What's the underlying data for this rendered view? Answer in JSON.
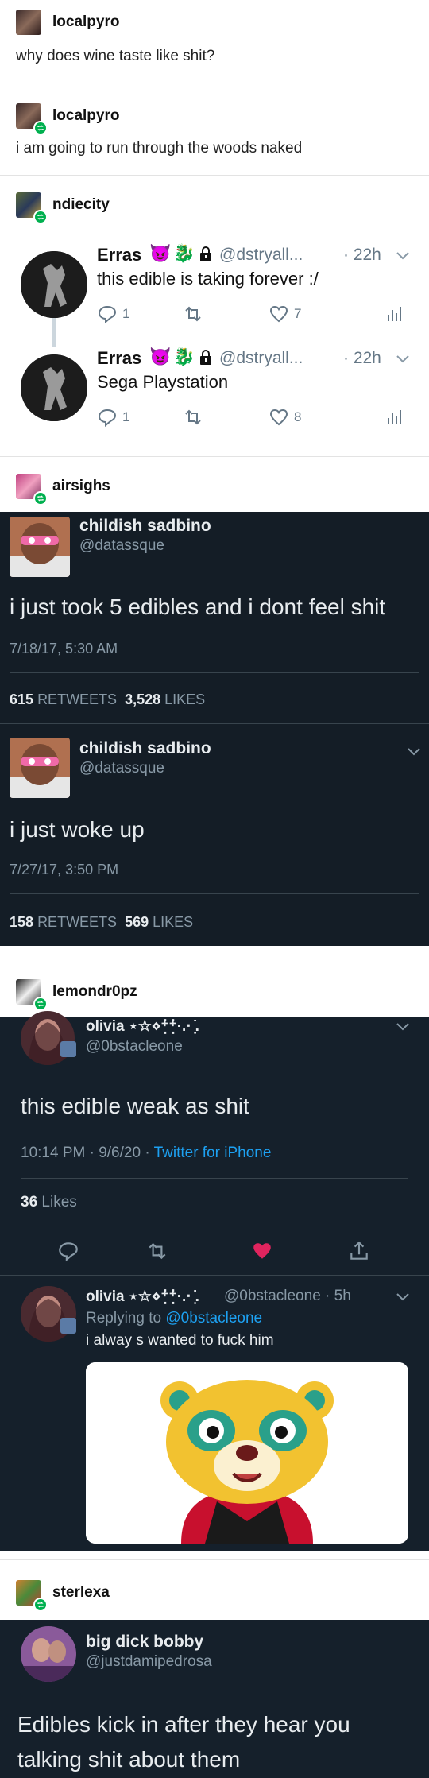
{
  "posts": {
    "p1": {
      "username": "localpyro",
      "text": "why does wine taste like shit?"
    },
    "p2": {
      "username": "localpyro",
      "text": "i am going to run through the woods naked"
    },
    "p3": {
      "username": "ndiecity",
      "tweets": [
        {
          "name": "Erras",
          "handle": "@dstryall...",
          "time": "· 22h",
          "text": "this edible is taking forever :/",
          "replies": "1",
          "likes": "7"
        },
        {
          "name": "Erras",
          "handle": "@dstryall...",
          "time": "· 22h",
          "text": "Sega Playstation",
          "replies": "1",
          "likes": "8"
        }
      ]
    },
    "p4": {
      "username": "airsighs",
      "tweets": [
        {
          "name": "childish sadbino",
          "handle": "@datassque",
          "text": "i just took 5 edibles and i dont feel shit",
          "date": "7/18/17, 5:30 AM",
          "retweets": "615",
          "retweets_label": "RETWEETS",
          "likes": "3,528",
          "likes_label": "LIKES"
        },
        {
          "name": "childish sadbino",
          "handle": "@datassque",
          "text": "i just woke up",
          "date": "7/27/17, 3:50 PM",
          "retweets": "158",
          "retweets_label": "RETWEETS",
          "likes": "569",
          "likes_label": "LIKES"
        }
      ]
    },
    "p5": {
      "username": "lemondr0pz",
      "main": {
        "name": "olivia ⋆☆⋄⁺̣̇⁺̣̇·.⋅ ̣̇.",
        "handle": "@0bstacleone",
        "text": "this edible weak as shit",
        "time": "10:14 PM · 9/6/20 · ",
        "client": "Twitter for iPhone",
        "likes": "36",
        "likes_label": "Likes"
      },
      "reply": {
        "name": "olivia ⋆☆⋄⁺̣̇⁺̣̇·.⋅ ̣̇.",
        "handle": "@0bstacleone · 5h",
        "replying_prefix": "Replying to ",
        "replying_to": "@0bstacleone",
        "text": "i alway s wanted to fuck him"
      }
    },
    "p6": {
      "username": "sterlexa",
      "tweet": {
        "name": "big dick bobby",
        "handle": "@justdamipedrosa",
        "text_line1": "Edibles kick in after they hear you",
        "text_line2": "talking shit about them"
      }
    }
  },
  "colors": {
    "reblog": "#00b04f",
    "dark_bg": "#15202b",
    "dark_bg2": "#141d26",
    "link": "#1da1f2",
    "like": "#e0245e",
    "muted": "#8899a6"
  },
  "icons": [
    "retweet-icon",
    "reply-icon",
    "heart-icon",
    "analytics-icon",
    "share-icon",
    "chevron-down-icon",
    "lock-icon",
    "devil-emoji-icon",
    "dragon-emoji-icon"
  ]
}
